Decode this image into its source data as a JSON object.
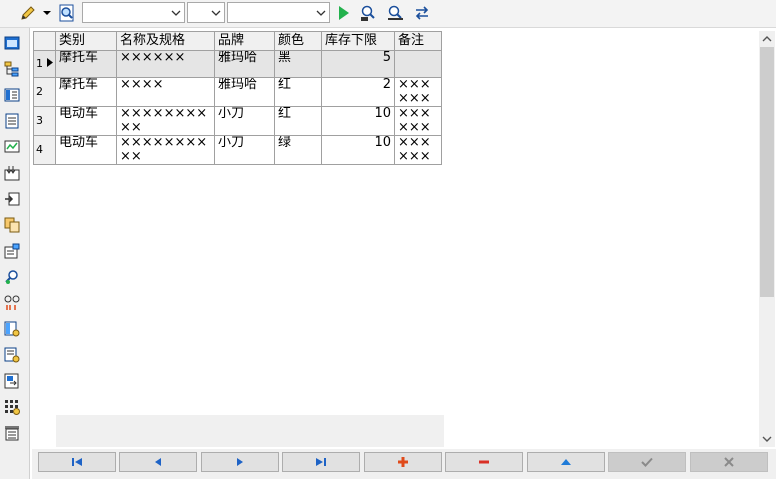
{
  "toolbar": {
    "combo_text_1": "",
    "combo_text_2": "",
    "combo_text_3": ""
  },
  "grid": {
    "columns": [
      "类别",
      "名称及规格",
      "品牌",
      "颜色",
      "库存下限",
      "备注"
    ],
    "rows": [
      {
        "num": "1",
        "category": "摩托车",
        "name": "××××××",
        "brand": "雅玛哈",
        "color": "黑",
        "min_stock": "5",
        "note": ""
      },
      {
        "num": "2",
        "category": "摩托车",
        "name": "××××",
        "brand": "雅玛哈",
        "color": "红",
        "min_stock": "2",
        "note": "××××××"
      },
      {
        "num": "3",
        "category": "电动车",
        "name": "××××××××××",
        "brand": "小刀",
        "color": "红",
        "min_stock": "10",
        "note": "××××××"
      },
      {
        "num": "4",
        "category": "电动车",
        "name": "××××××××××",
        "brand": "小刀",
        "color": "绿",
        "min_stock": "10",
        "note": "××××××"
      }
    ]
  },
  "colors": {
    "play_green": "#22b14c",
    "add_red": "#e04a1a",
    "delete_red": "#d93025",
    "up_blue": "#1f7bd8",
    "nav_blue": "#1e63c6"
  }
}
